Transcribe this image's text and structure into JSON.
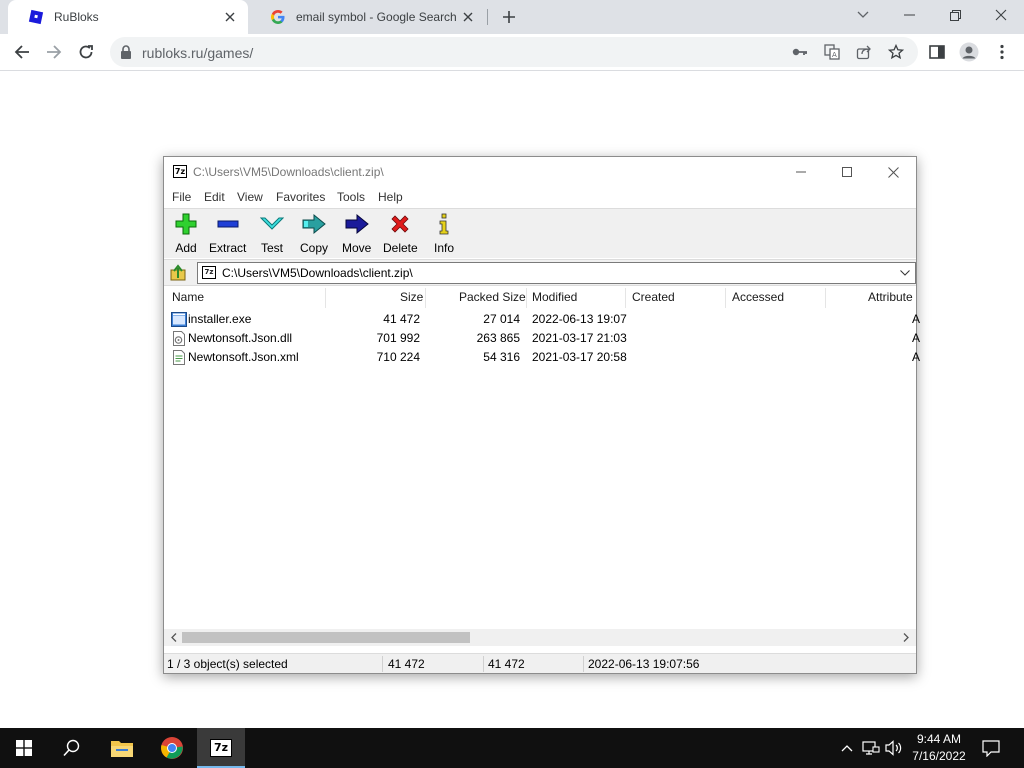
{
  "browser": {
    "tabs": [
      {
        "title": "RuBloks",
        "active": true
      },
      {
        "title": "email symbol - Google Search",
        "active": false
      }
    ],
    "url": "rubloks.ru/games/"
  },
  "sevenzip": {
    "title": "C:\\Users\\VM5\\Downloads\\client.zip\\",
    "menu": [
      "File",
      "Edit",
      "View",
      "Favorites",
      "Tools",
      "Help"
    ],
    "toolbar": [
      "Add",
      "Extract",
      "Test",
      "Copy",
      "Move",
      "Delete",
      "Info"
    ],
    "path": "C:\\Users\\VM5\\Downloads\\client.zip\\",
    "columns": [
      "Name",
      "Size",
      "Packed Size",
      "Modified",
      "Created",
      "Accessed",
      "Attribute"
    ],
    "files": [
      {
        "name": "installer.exe",
        "size": "41 472",
        "packed": "27 014",
        "modified": "2022-06-13 19:07",
        "attr": "A"
      },
      {
        "name": "Newtonsoft.Json.dll",
        "size": "701 992",
        "packed": "263 865",
        "modified": "2021-03-17 21:03",
        "attr": "A"
      },
      {
        "name": "Newtonsoft.Json.xml",
        "size": "710 224",
        "packed": "54 316",
        "modified": "2021-03-17 20:58",
        "attr": "A"
      }
    ],
    "status": {
      "selected": "1 / 3 object(s) selected",
      "size": "41 472",
      "packed": "41 472",
      "modified": "2022-06-13 19:07:56"
    }
  },
  "taskbar": {
    "time": "9:44 AM",
    "date": "7/16/2022",
    "active_app_label": "7z"
  },
  "colors": {
    "tabstrip": "#dee1e6",
    "taskbar": "#101010",
    "selected_row": "#ffffff"
  }
}
